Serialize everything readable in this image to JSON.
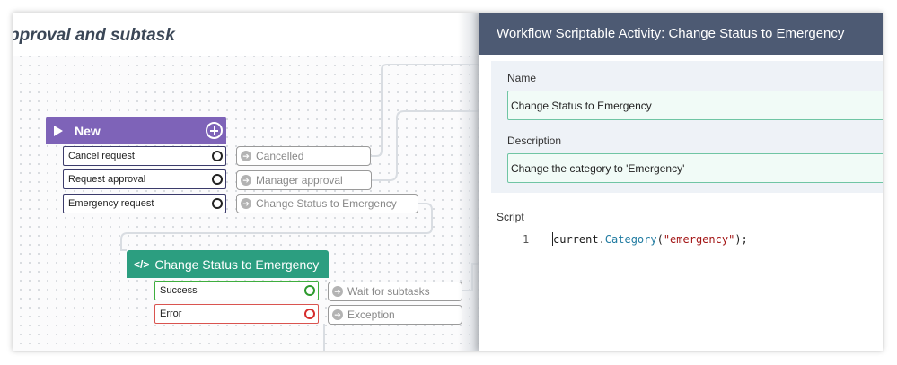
{
  "canvas": {
    "title": "pproval and subtask",
    "nodes": {
      "new": {
        "title": "New",
        "conditions": [
          "Cancel request",
          "Request approval",
          "Emergency request"
        ],
        "targets": [
          "Cancelled",
          "Manager approval",
          "Change Status to Emergency"
        ]
      },
      "change_status": {
        "code_icon": "</>",
        "title": "Change Status to Emergency",
        "conditions": [
          "Success",
          "Error"
        ],
        "targets": [
          "Wait for subtasks",
          "Exception"
        ]
      }
    },
    "colors": {
      "start_node": "#7e63b8",
      "script_node": "#2c9e80",
      "success": "#2d9a2d",
      "error": "#d62c2c"
    }
  },
  "panel": {
    "title": "Workflow Scriptable Activity: Change Status to Emergency",
    "name_label": "Name",
    "name_value": "Change Status to Emergency",
    "description_label": "Description",
    "description_value": "Change the category to 'Emergency'",
    "script_label": "Script",
    "script": {
      "line_number": "1",
      "object": "current.",
      "method": "Category",
      "open": "(",
      "argument": "\"emergency\"",
      "close": ");"
    },
    "colors": {
      "header": "#4d5a73",
      "field_border": "#70c5a4"
    }
  }
}
